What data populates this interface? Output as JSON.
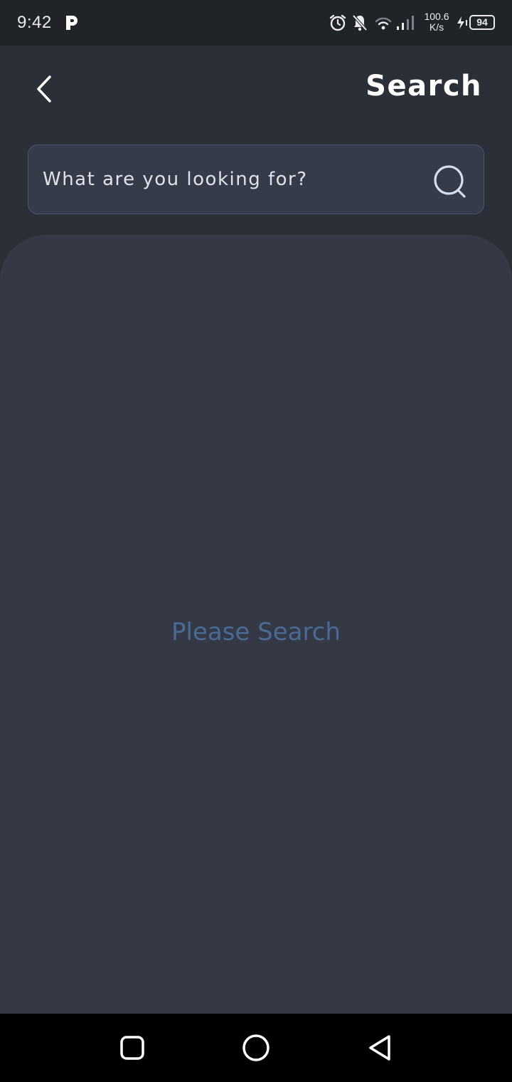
{
  "status_bar": {
    "time": "9:42",
    "net_speed_value": "100.6",
    "net_speed_unit": "K/s",
    "battery_level": "94",
    "icons": [
      "p-app-icon",
      "alarm-icon",
      "notifications-off-icon",
      "wifi-icon",
      "signal-icon",
      "charging-icon",
      "battery-icon"
    ]
  },
  "header": {
    "title": "Search",
    "back_icon": "chevron-left-icon"
  },
  "search": {
    "placeholder": "What are you looking for?",
    "value": "",
    "icon": "search-icon"
  },
  "content": {
    "empty_message": "Please Search"
  },
  "nav_bar": {
    "icons": [
      "recents-square-icon",
      "home-circle-icon",
      "back-triangle-icon"
    ]
  },
  "colors": {
    "background": "#2b2f38",
    "panel": "#353945",
    "status_bar": "#202328",
    "accent_text": "#4a6a96",
    "search_border": "#4b5670"
  }
}
